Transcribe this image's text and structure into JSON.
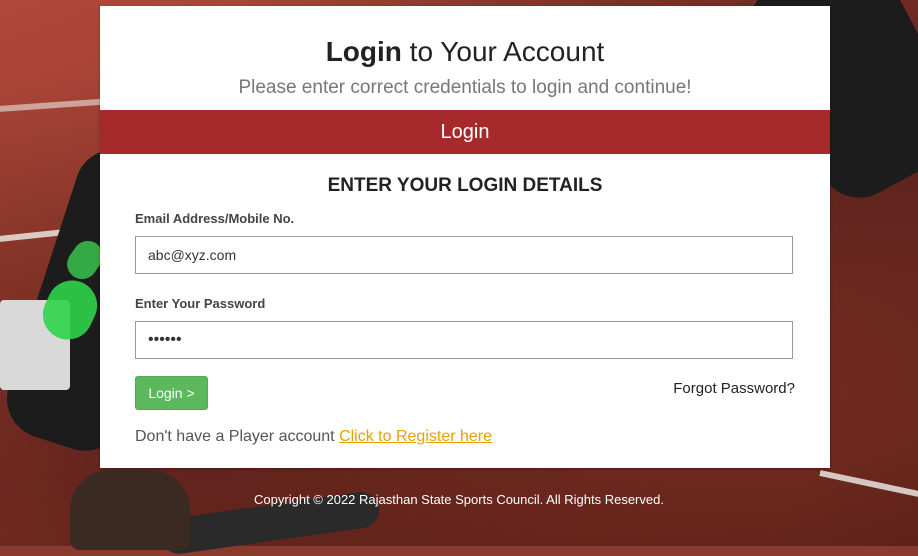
{
  "header": {
    "title_bold": "Login",
    "title_rest": " to Your Account",
    "subtitle": "Please enter correct credentials to login and continue!"
  },
  "tab": {
    "label": "Login"
  },
  "form": {
    "heading": "ENTER YOUR LOGIN DETAILS",
    "email_label": "Email Address/Mobile No.",
    "email_value": "abc@xyz.com",
    "password_label": "Enter Your Password",
    "password_value": "••••••",
    "login_button": "Login >",
    "forgot_link": "Forgot Password?",
    "register_prompt": "Don't have a Player account ",
    "register_link": "Click to Register here"
  },
  "footer": {
    "copyright": "Copyright © 2022 Rajasthan State Sports Council. All Rights Reserved."
  },
  "colors": {
    "tab_bg": "#a6292b",
    "button_green": "#5cb85c",
    "link_orange": "#e6a100"
  }
}
